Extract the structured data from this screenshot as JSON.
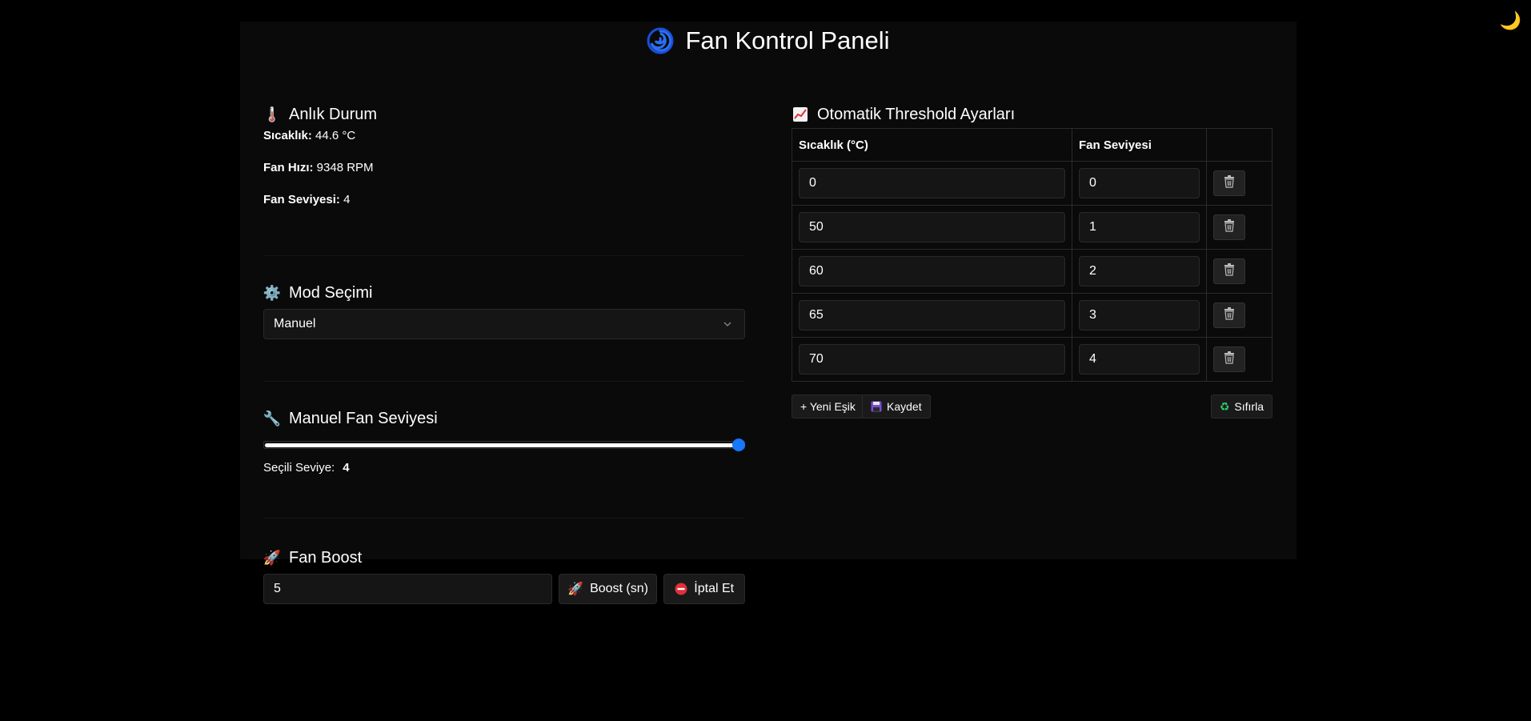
{
  "theme_toggle_icon": "moon-icon",
  "header": {
    "title": "Fan Kontrol Paneli",
    "logo_icon": "cyclone-icon"
  },
  "status": {
    "title": "Anlık Durum",
    "temp_label": "Sıcaklık:",
    "temp_value": "44.6 °C",
    "speed_label": "Fan Hızı:",
    "speed_value": "9348 RPM",
    "level_label": "Fan Seviyesi:",
    "level_value": "4"
  },
  "mode": {
    "title": "Mod Seçimi",
    "selected": "Manuel"
  },
  "manual": {
    "title": "Manuel Fan Seviyesi",
    "level_fraction": 1.0,
    "selected_label": "Seçili Seviye:",
    "selected_value": "4"
  },
  "boost": {
    "title": "Fan Boost",
    "input_value": "5",
    "boost_label": "Boost (sn)",
    "cancel_label": "İptal Et"
  },
  "threshold": {
    "title": "Otomatik Threshold Ayarları",
    "col_temp": "Sıcaklık (°C)",
    "col_level": "Fan Seviyesi",
    "rows": [
      {
        "temp": "0",
        "level": "0"
      },
      {
        "temp": "50",
        "level": "1"
      },
      {
        "temp": "60",
        "level": "2"
      },
      {
        "temp": "65",
        "level": "3"
      },
      {
        "temp": "70",
        "level": "4"
      }
    ],
    "add_label": "+ Yeni Eşik",
    "save_label": "Kaydet",
    "reset_label": "Sıfırla"
  },
  "colors": {
    "accent": "#1677ff",
    "background": "#000000",
    "panel": "#0a0a0a"
  }
}
